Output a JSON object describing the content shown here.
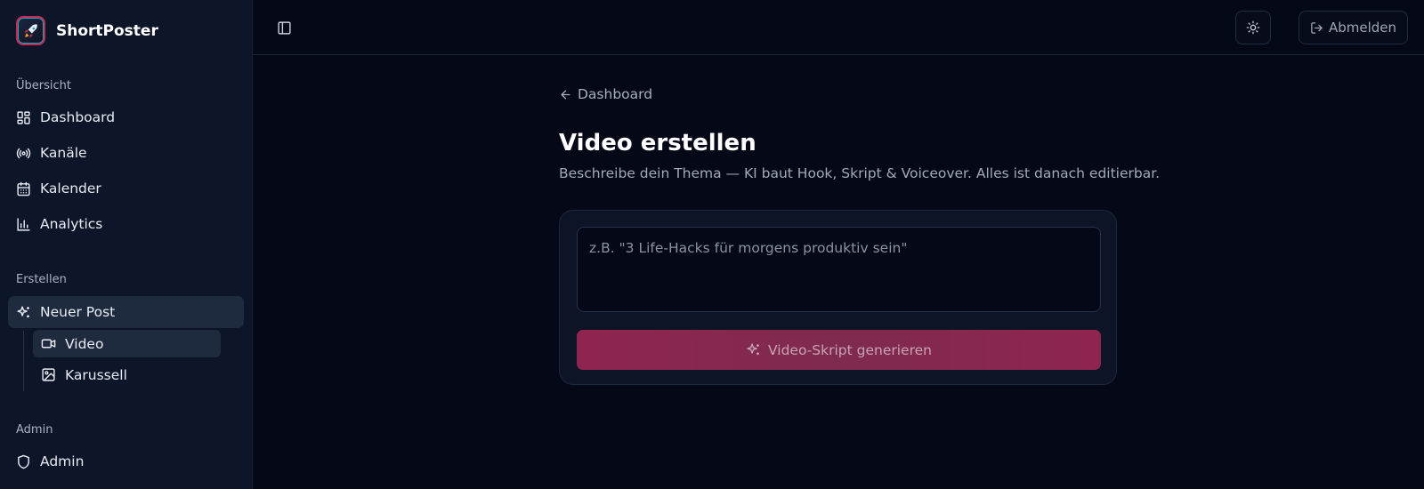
{
  "app": {
    "name": "ShortPoster"
  },
  "sidebar": {
    "sections": [
      {
        "label": "Übersicht",
        "items": [
          {
            "label": "Dashboard",
            "icon": "dashboard-grid-icon"
          },
          {
            "label": "Kanäle",
            "icon": "broadcast-icon"
          },
          {
            "label": "Kalender",
            "icon": "calendar-icon"
          },
          {
            "label": "Analytics",
            "icon": "bar-chart-icon"
          }
        ]
      },
      {
        "label": "Erstellen",
        "items": [
          {
            "label": "Neuer Post",
            "icon": "sparkles-icon",
            "active": true
          }
        ],
        "subitems": [
          {
            "label": "Video",
            "icon": "video-icon",
            "active": true
          },
          {
            "label": "Karussell",
            "icon": "image-icon"
          }
        ]
      },
      {
        "label": "Admin",
        "items": [
          {
            "label": "Admin",
            "icon": "shield-icon"
          }
        ]
      }
    ]
  },
  "topbar": {
    "logout_label": "Abmelden"
  },
  "main": {
    "back_label": "Dashboard",
    "title": "Video erstellen",
    "subtitle": "Beschreibe dein Thema — KI baut Hook, Skript & Voiceover. Alles ist danach editierbar.",
    "input": {
      "value": "",
      "placeholder": "z.B. \"3 Life-Hacks für morgens produktiv sein\""
    },
    "generate_label": "Video-Skript generieren"
  },
  "colors": {
    "background": "#050816",
    "sidebar": "#0d1628",
    "accent": "#8e2550",
    "active_item": "#1e2a3d"
  }
}
